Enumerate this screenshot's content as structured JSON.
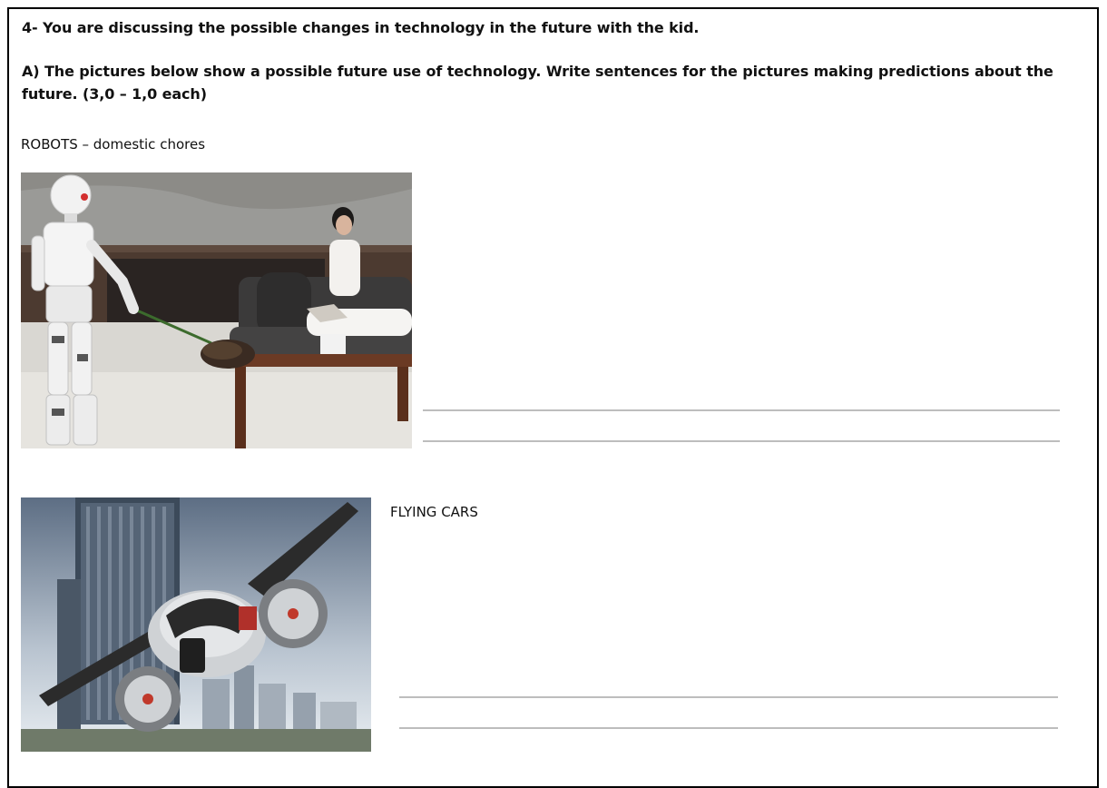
{
  "worksheet": {
    "question_title": "4- You are discussing the possible changes in technology in the future with the kid.",
    "instruction": "A) The pictures below show a possible future use of technology. Write sentences for the pictures making predictions about the future. (3,0 – 1,0 each)",
    "items": [
      {
        "label": "ROBOTS – domestic chores",
        "picture": "robot-dusting-living-room-photo",
        "answer_lines": 2
      },
      {
        "label": "FLYING CARS",
        "picture": "flying-car-city-photo",
        "answer_lines": 2
      }
    ]
  },
  "colors": {
    "border": "#000000",
    "answer_line": "#bdbdbd",
    "text": "#111111"
  }
}
